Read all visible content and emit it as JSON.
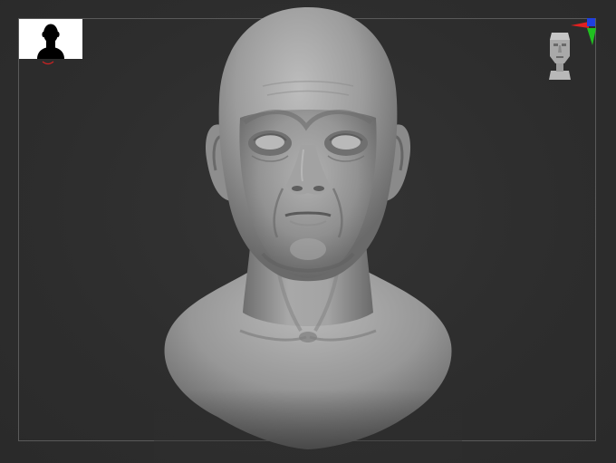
{
  "viewport": {
    "background": "#2e2e2e",
    "frame_color": "#5a5a5a"
  },
  "thumbnail": {
    "icon": "head-silhouette-icon",
    "background": "#ffffff",
    "silhouette_color": "#000000",
    "marker_color": "#cc2222"
  },
  "model": {
    "icon": "sculpted-head-bust",
    "material_color": "#9a9a9a"
  },
  "navigation": {
    "icon": "head-navigation-cube-icon"
  },
  "axis_gizmo": {
    "icon": "xyz-axis-gizmo-icon",
    "colors": {
      "x": "#e02020",
      "y": "#20c020",
      "z": "#2040e0"
    }
  }
}
